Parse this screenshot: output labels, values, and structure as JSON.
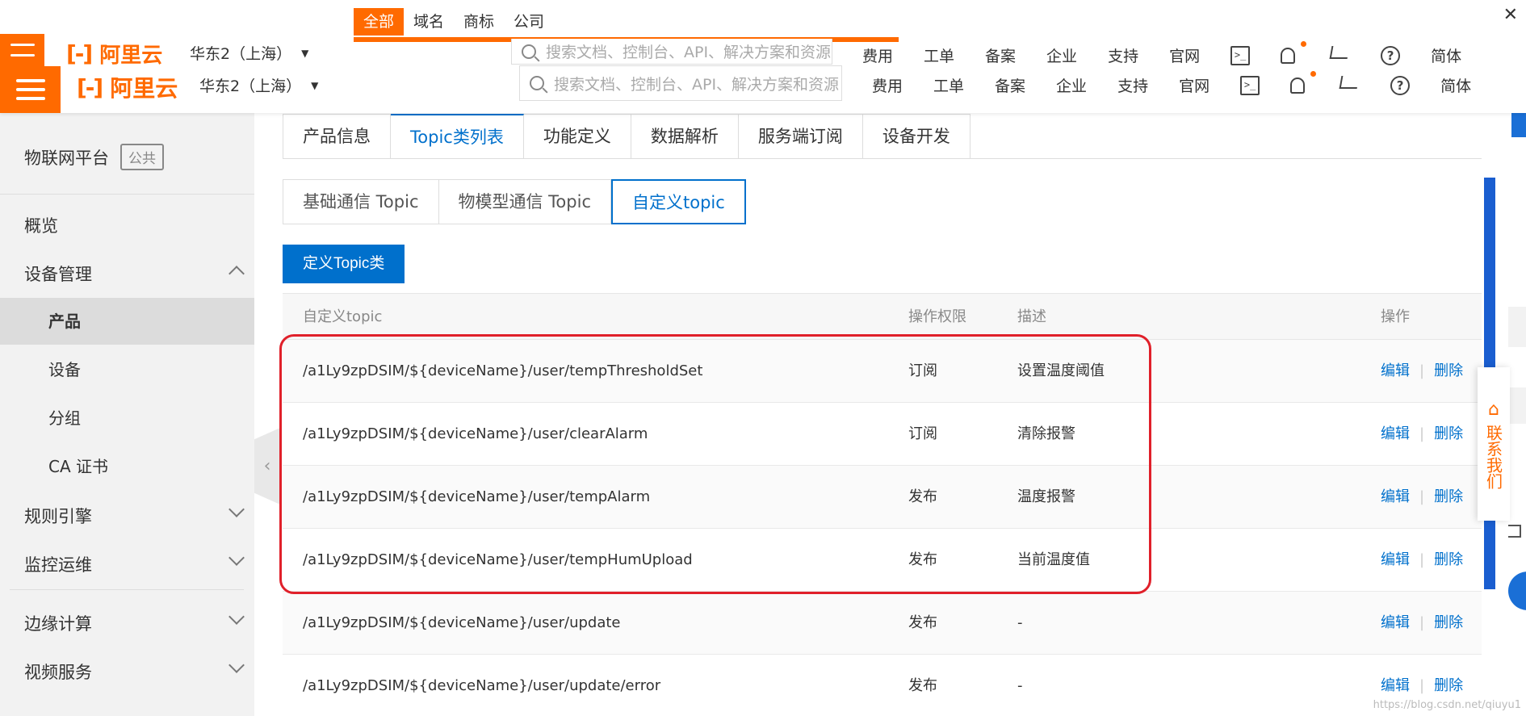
{
  "ghost_header": {
    "tabs": [
      "全部",
      "域名",
      "商标",
      "公司"
    ],
    "region": "华东2（上海）",
    "search_placeholder": "搜索文档、控制台、API、解决方案和资源",
    "nav": [
      "费用",
      "工单",
      "备案",
      "企业",
      "支持",
      "官网"
    ],
    "lang": "简体"
  },
  "header": {
    "logo_text": "阿里云",
    "region": "华东2（上海）",
    "search_placeholder": "搜索文档、控制台、API、解决方案和资源",
    "nav": [
      "费用",
      "工单",
      "备案",
      "企业",
      "支持",
      "官网"
    ],
    "lang": "简体",
    "accent_color": "#ff6a00"
  },
  "sidebar": {
    "title": "物联网平台",
    "badge": "公共",
    "items": [
      {
        "label": "概览"
      },
      {
        "label": "设备管理"
      },
      {
        "label": "规则引擎"
      },
      {
        "label": "监控运维"
      },
      {
        "label": "边缘计算"
      },
      {
        "label": "视频服务"
      }
    ],
    "sub_items": [
      "产品",
      "设备",
      "分组",
      "CA 证书"
    ],
    "active_sub": "产品"
  },
  "main": {
    "tabs": [
      "产品信息",
      "Topic类列表",
      "功能定义",
      "数据解析",
      "服务端订阅",
      "设备开发"
    ],
    "active_tab": "Topic类列表",
    "subtabs": [
      "基础通信 Topic",
      "物模型通信 Topic",
      "自定义topic"
    ],
    "active_subtab": "自定义topic",
    "define_button": "定义Topic类",
    "table": {
      "headers": [
        "自定义topic",
        "操作权限",
        "描述",
        "操作"
      ],
      "rows": [
        {
          "topic": "/a1Ly9zpDSIM/${deviceName}/user/tempThresholdSet",
          "perm": "订阅",
          "desc": "设置温度阈值"
        },
        {
          "topic": "/a1Ly9zpDSIM/${deviceName}/user/clearAlarm",
          "perm": "订阅",
          "desc": "清除报警"
        },
        {
          "topic": "/a1Ly9zpDSIM/${deviceName}/user/tempAlarm",
          "perm": "发布",
          "desc": "温度报警"
        },
        {
          "topic": "/a1Ly9zpDSIM/${deviceName}/user/tempHumUpload",
          "perm": "发布",
          "desc": "当前温度值"
        },
        {
          "topic": "/a1Ly9zpDSIM/${deviceName}/user/update",
          "perm": "发布",
          "desc": "-"
        },
        {
          "topic": "/a1Ly9zpDSIM/${deviceName}/user/update/error",
          "perm": "发布",
          "desc": "-"
        }
      ],
      "edit_label": "编辑",
      "delete_label": "删除",
      "separator": "|"
    },
    "link_color": "#0070cc"
  },
  "float_panel": {
    "label": "联系我们"
  },
  "watermark": "https://blog.csdn.net/qiuyu1"
}
